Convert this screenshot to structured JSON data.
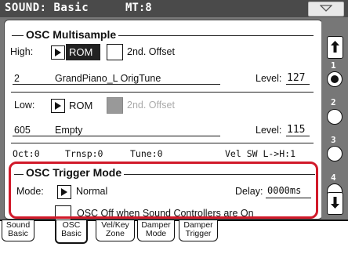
{
  "title_bar": {
    "title": "SOUND: Basic",
    "mode": "MT:8"
  },
  "osc_multisample": {
    "title": "OSC Multisample",
    "high": {
      "label": "High:",
      "source": "ROM",
      "second_offset": "2nd. Offset",
      "number": "2",
      "name": "GrandPiano_L OrigTune",
      "level_label": "Level:",
      "level_value": "127"
    },
    "low": {
      "label": "Low:",
      "source": "ROM",
      "second_offset": "2nd. Offset",
      "number": "605",
      "name": "Empty",
      "level_label": "Level:",
      "level_value": "115"
    },
    "params": {
      "oct": "Oct:0",
      "trnsp": "Trnsp:0",
      "tune": "Tune:0",
      "vel_sw": "Vel SW L->H:1"
    }
  },
  "osc_trigger_mode": {
    "title": "OSC Trigger Mode",
    "mode_label": "Mode:",
    "mode_value": "Normal",
    "delay_label": "Delay:",
    "delay_value": "0000ms",
    "checkbox_label": "OSC Off when Sound Controllers are On"
  },
  "page_selector": {
    "pages": [
      "1",
      "2",
      "3",
      "4"
    ],
    "selected": "1"
  },
  "tabs": [
    {
      "line1": "Sound",
      "line2": "Basic"
    },
    {
      "line1": "OSC",
      "line2": "Basic"
    },
    {
      "line1": "Vel/Key",
      "line2": "Zone"
    },
    {
      "line1": "Damper",
      "line2": "Mode"
    },
    {
      "line1": "Damper",
      "line2": "Trigger"
    }
  ],
  "colors": {
    "highlight": "#d11a2a",
    "title_bar": "#4a4a4a",
    "background": "#777777"
  }
}
